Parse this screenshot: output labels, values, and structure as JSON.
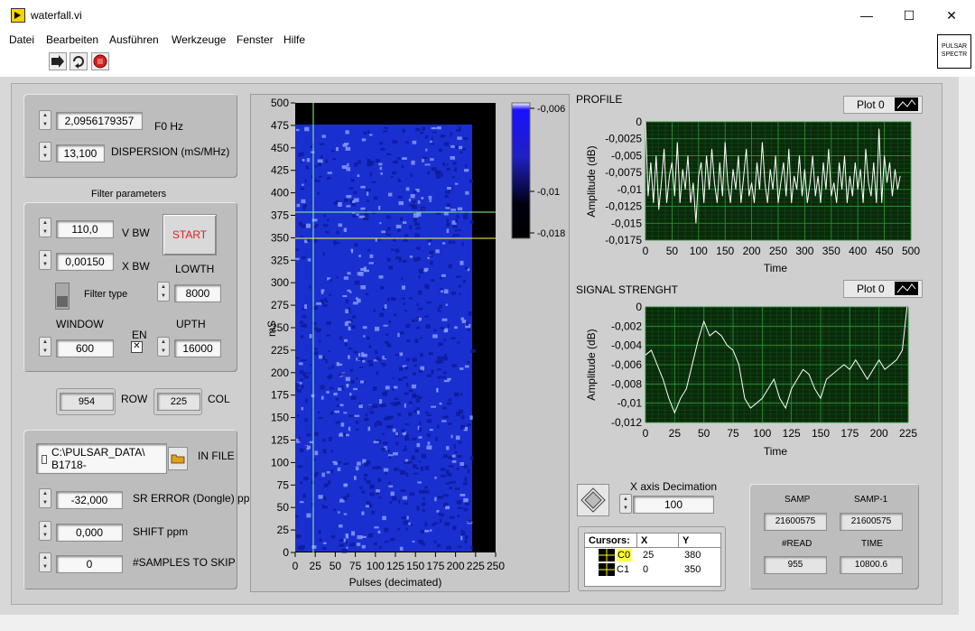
{
  "window": {
    "title": "waterfall.vi",
    "minimize": "—",
    "maximize": "☐",
    "close": "✕"
  },
  "menu": [
    "Datei",
    "Bearbeiten",
    "Ausführen",
    "Werkzeuge",
    "Fenster",
    "Hilfe"
  ],
  "vi_icon": {
    "line1": "PULSAR",
    "line2": "SPECTR"
  },
  "controls": {
    "f0": {
      "value": "2,0956179357",
      "label": "F0 Hz"
    },
    "dispersion": {
      "value": "13,100",
      "label": "DISPERSION (mS/MHz)"
    },
    "filter_title": "Filter parameters",
    "vbw": {
      "value": "110,0",
      "label": "V BW"
    },
    "xbw": {
      "value": "0,00150",
      "label": "X BW"
    },
    "start_label": "START",
    "lowth": {
      "value": "8000",
      "label": "LOWTH"
    },
    "filter_type_label": "Filter type",
    "window": {
      "value": "600",
      "label": "WINDOW"
    },
    "en_label": "EN",
    "upth": {
      "value": "16000",
      "label": "UPTH"
    },
    "row": {
      "value": "954",
      "label": "ROW"
    },
    "col": {
      "value": "225",
      "label": "COL"
    },
    "in_file": {
      "line1": "C:\\PULSAR_DATA\\",
      "line2": "B1718-",
      "label": "IN FILE"
    },
    "sr_error": {
      "value": "-32,000",
      "label": "SR ERROR (Dongle) ppm"
    },
    "shift": {
      "value": "0,000",
      "label": "SHIFT ppm"
    },
    "skip": {
      "value": "0",
      "label": "#SAMPLES TO SKIP"
    }
  },
  "waterfall": {
    "ylabel": "mS",
    "xlabel": "Pulses (decimated)",
    "xticks": [
      "0",
      "25",
      "50",
      "75",
      "100",
      "125",
      "150",
      "175",
      "200",
      "225",
      "250"
    ],
    "yticks": [
      "0",
      "25",
      "50",
      "75",
      "100",
      "125",
      "150",
      "175",
      "200",
      "225",
      "250",
      "275",
      "300",
      "325",
      "350",
      "375",
      "400",
      "425",
      "450",
      "475",
      "500"
    ],
    "colorbar_ticks": [
      "-0,006",
      "-0,01",
      "-0,018"
    ]
  },
  "profile": {
    "title": "PROFILE",
    "legend": "Plot 0",
    "ylabel": "Amplitude (dB)",
    "xlabel": "Time",
    "yticks": [
      "0",
      "-0,0025",
      "-0,005",
      "-0,0075",
      "-0,01",
      "-0,0125",
      "-0,015",
      "-0,0175"
    ],
    "xticks": [
      "0",
      "50",
      "100",
      "150",
      "200",
      "250",
      "300",
      "350",
      "400",
      "450",
      "500"
    ]
  },
  "signal": {
    "title": "SIGNAL STRENGHT",
    "legend": "Plot 0",
    "ylabel": "Amplitude (dB)",
    "xlabel": "Time",
    "yticks": [
      "0",
      "-0,002",
      "-0,004",
      "-0,006",
      "-0,008",
      "-0,01",
      "-0,012"
    ],
    "xticks": [
      "0",
      "25",
      "50",
      "75",
      "100",
      "125",
      "150",
      "175",
      "200",
      "225"
    ]
  },
  "decimation": {
    "label": "X axis Decimation",
    "value": "100"
  },
  "cursors": {
    "header": [
      "Cursors:",
      "X",
      "Y"
    ],
    "rows": [
      {
        "name": "C0",
        "x": "25",
        "y": "380"
      },
      {
        "name": "C1",
        "x": "0",
        "y": "350"
      }
    ]
  },
  "samp": {
    "samp_label": "SAMP",
    "samp_value": "21600575",
    "samp1_label": "SAMP-1",
    "samp1_value": "21600575",
    "read_label": "#READ",
    "read_value": "955",
    "time_label": "TIME",
    "time_value": "10800.6"
  },
  "colors": {
    "plot_bg": "#0a2a0a",
    "grid": "#1f7a2a",
    "trace": "#ffffff",
    "waterfall_base": "#1a2fd0",
    "start_text": "#e02020"
  },
  "chart_data": [
    {
      "type": "line",
      "title": "PROFILE",
      "xlabel": "Time",
      "ylabel": "Amplitude (dB)",
      "xlim": [
        0,
        500
      ],
      "ylim": [
        -0.0175,
        0
      ],
      "series": [
        {
          "name": "Plot 0",
          "x": [
            0,
            5,
            10,
            15,
            20,
            25,
            30,
            35,
            40,
            45,
            50,
            55,
            60,
            65,
            70,
            75,
            80,
            85,
            90,
            95,
            100,
            105,
            110,
            115,
            120,
            125,
            130,
            135,
            140,
            145,
            150,
            155,
            160,
            165,
            170,
            175,
            180,
            185,
            190,
            195,
            200,
            205,
            210,
            215,
            220,
            225,
            230,
            235,
            240,
            245,
            250,
            255,
            260,
            265,
            270,
            275,
            280,
            285,
            290,
            295,
            300,
            305,
            310,
            315,
            320,
            325,
            330,
            335,
            340,
            345,
            350,
            355,
            360,
            365,
            370,
            375,
            380,
            385,
            390,
            395,
            400,
            405,
            410,
            415,
            420,
            425,
            430,
            435,
            440,
            445,
            450,
            455,
            460,
            465,
            470,
            475,
            480
          ],
          "values": [
            0,
            -0.011,
            -0.006,
            -0.012,
            -0.005,
            -0.013,
            -0.009,
            -0.004,
            -0.012,
            -0.008,
            -0.006,
            -0.011,
            -0.003,
            -0.012,
            -0.007,
            -0.01,
            -0.005,
            -0.012,
            -0.009,
            -0.015,
            -0.008,
            -0.006,
            -0.012,
            -0.005,
            -0.01,
            -0.004,
            -0.009,
            -0.012,
            -0.006,
            -0.011,
            -0.003,
            -0.009,
            -0.012,
            -0.007,
            -0.01,
            -0.005,
            -0.012,
            -0.008,
            -0.004,
            -0.011,
            -0.009,
            -0.012,
            -0.006,
            -0.01,
            -0.003,
            -0.009,
            -0.012,
            -0.007,
            -0.01,
            -0.005,
            -0.012,
            -0.009,
            -0.006,
            -0.011,
            -0.004,
            -0.012,
            -0.008,
            -0.01,
            -0.005,
            -0.011,
            -0.007,
            -0.012,
            -0.009,
            -0.005,
            -0.011,
            -0.008,
            -0.012,
            -0.006,
            -0.01,
            -0.004,
            -0.011,
            -0.009,
            -0.012,
            -0.006,
            -0.01,
            -0.005,
            -0.012,
            -0.008,
            -0.011,
            -0.006,
            -0.01,
            -0.007,
            -0.012,
            -0.004,
            -0.009,
            -0.011,
            -0.006,
            -0.012,
            -0.001,
            -0.012,
            -0.005,
            -0.009,
            -0.006,
            -0.011,
            -0.007,
            -0.01,
            -0.008
          ]
        }
      ]
    },
    {
      "type": "line",
      "title": "SIGNAL STRENGHT",
      "xlabel": "Time",
      "ylabel": "Amplitude (dB)",
      "xlim": [
        0,
        225
      ],
      "ylim": [
        -0.012,
        0
      ],
      "series": [
        {
          "name": "Plot 0",
          "x": [
            0,
            5,
            10,
            15,
            20,
            25,
            30,
            35,
            40,
            45,
            50,
            55,
            60,
            65,
            70,
            75,
            80,
            85,
            90,
            95,
            100,
            105,
            110,
            115,
            120,
            125,
            130,
            135,
            140,
            145,
            150,
            155,
            160,
            165,
            170,
            175,
            180,
            185,
            190,
            195,
            200,
            205,
            210,
            215,
            220,
            224
          ],
          "values": [
            -0.005,
            -0.0045,
            -0.006,
            -0.0075,
            -0.0095,
            -0.011,
            -0.0095,
            -0.0085,
            -0.006,
            -0.0035,
            -0.0015,
            -0.003,
            -0.0025,
            -0.003,
            -0.004,
            -0.0045,
            -0.006,
            -0.0095,
            -0.0105,
            -0.01,
            -0.0095,
            -0.0085,
            -0.0075,
            -0.0095,
            -0.0105,
            -0.0085,
            -0.0075,
            -0.0065,
            -0.007,
            -0.0085,
            -0.0095,
            -0.0075,
            -0.007,
            -0.0065,
            -0.006,
            -0.0065,
            -0.0055,
            -0.0065,
            -0.0075,
            -0.0065,
            -0.0055,
            -0.0065,
            -0.006,
            -0.0055,
            -0.0045,
            0
          ]
        }
      ]
    }
  ]
}
